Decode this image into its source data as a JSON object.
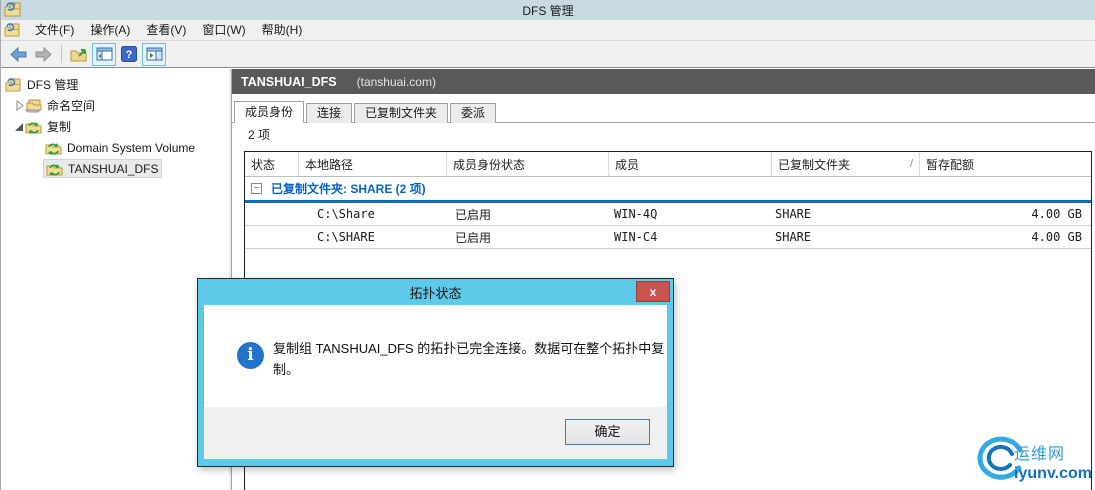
{
  "window": {
    "title": "DFS 管理"
  },
  "menu": {
    "items": [
      "文件(F)",
      "操作(A)",
      "查看(V)",
      "窗口(W)",
      "帮助(H)"
    ]
  },
  "toolbar": {
    "icons": [
      "back-icon",
      "forward-icon",
      "export-folder-icon",
      "console-tree-icon",
      "help-icon",
      "new-window-icon"
    ]
  },
  "sidebar": {
    "items": [
      {
        "label": "DFS 管理",
        "level": 0,
        "icon": "dfs-management-icon"
      },
      {
        "label": "命名空间",
        "level": 1,
        "icon": "namespace-icon",
        "expander": "collapsed"
      },
      {
        "label": "复制",
        "level": 1,
        "icon": "replication-icon",
        "expander": "expanded"
      },
      {
        "label": "Domain System Volume",
        "level": 2,
        "icon": "replication-group-icon"
      },
      {
        "label": "TANSHUAI_DFS",
        "level": 2,
        "icon": "replication-group-icon",
        "selected": true
      }
    ]
  },
  "content": {
    "header": {
      "title": "TANSHUAI_DFS",
      "subtitle": "(tanshuai.com)"
    },
    "tabs": [
      {
        "label": "成员身份",
        "active": true
      },
      {
        "label": "连接",
        "active": false
      },
      {
        "label": "已复制文件夹",
        "active": false
      },
      {
        "label": "委派",
        "active": false
      }
    ],
    "item_count": "2 项",
    "table": {
      "columns": [
        "状态",
        "本地路径",
        "成员身份状态",
        "成员",
        "已复制文件夹",
        "暂存配额"
      ],
      "sort_indicator": "/",
      "group": {
        "collapse_glyph": "−",
        "label": "已复制文件夹: SHARE (2 项)"
      },
      "rows": [
        {
          "status": "",
          "local_path": "C:\\Share",
          "membership_status": "已启用",
          "member": "WIN-4Q",
          "replicated_folder": "SHARE",
          "staging_quota": "4.00 GB"
        },
        {
          "status": "",
          "local_path": "C:\\SHARE",
          "membership_status": "已启用",
          "member": "WIN-C4",
          "replicated_folder": "SHARE",
          "staging_quota": "4.00 GB"
        }
      ]
    }
  },
  "dialog": {
    "title": "拓扑状态",
    "close_label": "x",
    "message": "复制组 TANSHUAI_DFS 的拓扑已完全连接。数据可在整个拓扑中复制。",
    "ok_label": "确定"
  },
  "watermark": {
    "site_name": "运维网",
    "site_url": "iyunv.com"
  },
  "colors": {
    "titlebar_bg": "#c8d9e1",
    "panel_header_bg": "#58595b",
    "group_text": "#0861c4",
    "group_underline": "#0f6ac4",
    "dialog_frame": "#5fc9e9",
    "close_button_bg": "#c85450",
    "info_icon_bg": "#2173c9",
    "ok_button_border": "#3c7fb1",
    "watermark_blue": "#2e9bd6"
  }
}
